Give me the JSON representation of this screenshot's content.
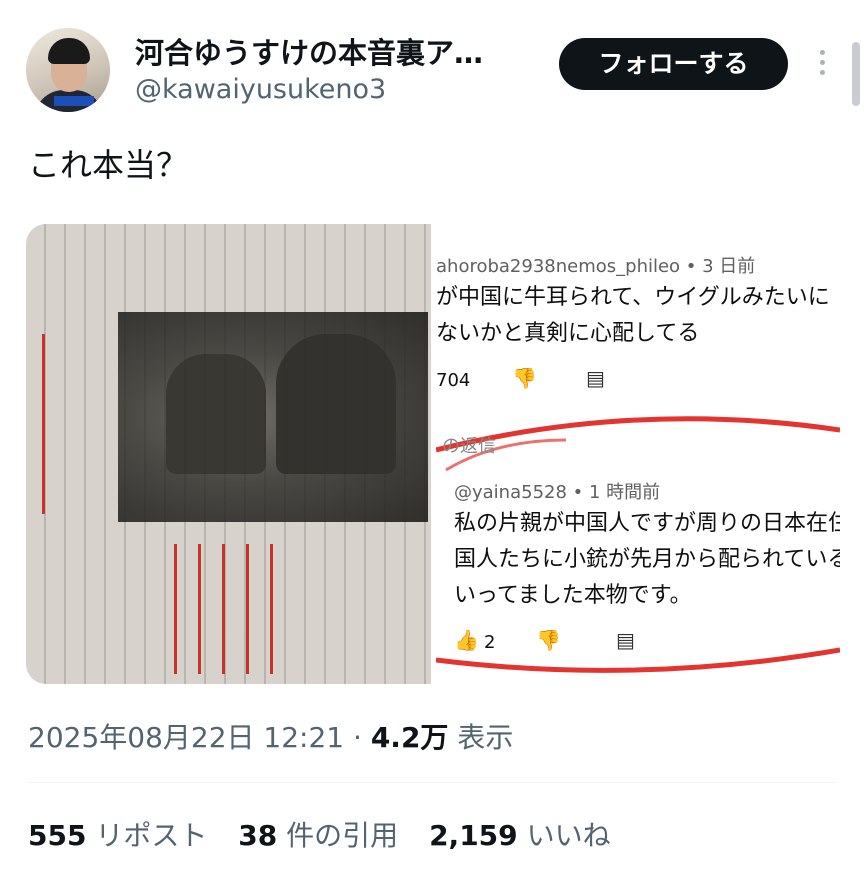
{
  "author": {
    "name": "河合ゆうすけの本音裏ア…",
    "handle": "@kawaiyusukeno3",
    "follow_label": "フォローする"
  },
  "tweet": {
    "text": "これ本当？"
  },
  "media_right": {
    "comment1": {
      "user": "ahoroba2938nemos_phileo • 3 日前",
      "line1": "が中国に牛耳られて、ウイグルみたいに",
      "line2": "ないかと真剣に心配してる",
      "likes": "704"
    },
    "replies_label": "の返信",
    "comment2": {
      "user": "@yaina5528 • 1 時間前",
      "line1": "私の片親が中国人ですが周りの日本在住",
      "line2": "国人たちに小銃が先月から配られている",
      "line3": "いってました本物です。",
      "likes": "2"
    }
  },
  "meta": {
    "datetime": "2025年08月22日 12:21 ·",
    "views_count": "4.2万",
    "views_label": "表示"
  },
  "stats": {
    "reposts_count": "555",
    "reposts_label": "リポスト",
    "quotes_count": "38",
    "quotes_label": "件の引用",
    "likes_count": "2,159",
    "likes_label": "いいね"
  },
  "colors": {
    "text_primary": "#0f1419",
    "text_secondary": "#536471",
    "follow_bg": "#0f1419",
    "highlight_red": "#e3342f"
  }
}
